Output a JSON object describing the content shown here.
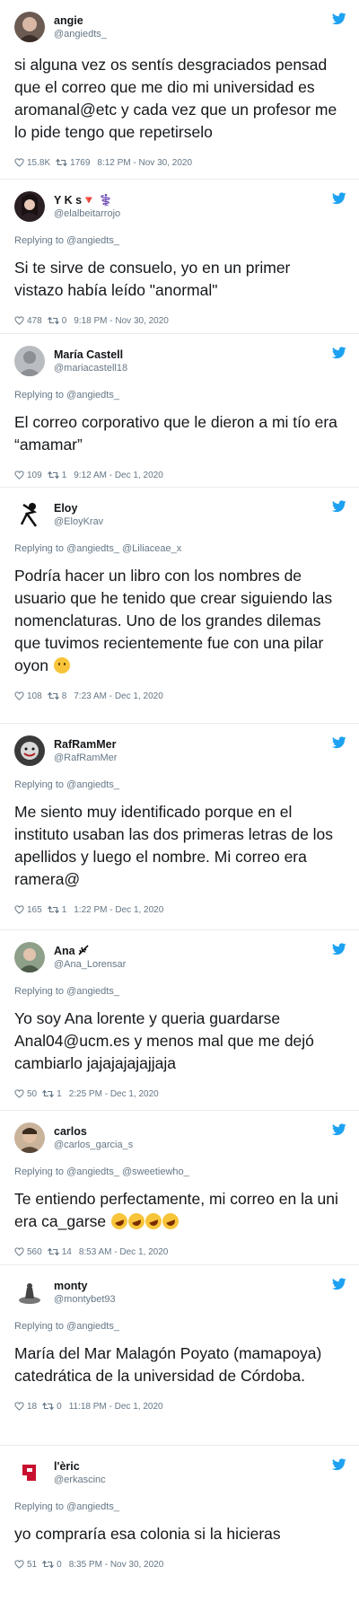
{
  "colors": {
    "accent": "#1da1f2",
    "muted": "#657786",
    "text": "#14171a"
  },
  "tweets": [
    {
      "name": "angie",
      "handle": "@angiedts_",
      "reply": "",
      "text": "si alguna vez os sentís desgraciados pensad que el correo que me dio mi universidad es aromanal@etc y cada vez que un profesor me lo pide tengo que repetirselo",
      "likes": "15.8K",
      "retweets": "1769",
      "time": "8:12 PM - Nov 30, 2020"
    },
    {
      "name": "Y      K  s🔻 ⚕️",
      "handle": "@elalbeitarrojo",
      "reply": "Replying to @angiedts_",
      "text": "Si te sirve de consuelo, yo en un primer vistazo había leído \"anormal\"",
      "likes": "478",
      "retweets": "0",
      "time": "9:18 PM - Nov 30, 2020"
    },
    {
      "name": "María Castell",
      "handle": "@mariacastell18",
      "reply": "Replying to @angiedts_",
      "text": "El correo corporativo que le dieron a mi tío era “amamar”",
      "likes": "109",
      "retweets": "1",
      "time": "9:12 AM - Dec 1, 2020"
    },
    {
      "name": "Eloy",
      "handle": "@EloyKrav",
      "reply": "Replying to @angiedts_ @Liliaceae_x",
      "text": "Podría hacer un libro con los nombres de usuario que he tenido que crear siguiendo las nomenclaturas. Uno de los grandes dilemas que tuvimos recientemente fue con una pilar oyon",
      "likes": "108",
      "retweets": "8",
      "time": "7:23 AM - Dec 1, 2020"
    },
    {
      "name": "RafRamMer",
      "handle": "@RafRamMer",
      "reply": "Replying to @angiedts_",
      "text": "Me siento muy identificado porque en el instituto usaban las dos primeras letras de los apellidos y luego el nombre. Mi correo era ramera@",
      "likes": "165",
      "retweets": "1",
      "time": "1:22 PM - Dec 1, 2020"
    },
    {
      "name": "Ana",
      "handle": "@Ana_Lorensar",
      "reply": "Replying to @angiedts_",
      "text": "Yo soy Ana lorente y queria guardarse Anal04@ucm.es y menos mal que me dejó cambiarlo jajajajajajjaja",
      "likes": "50",
      "retweets": "1",
      "time": "2:25 PM - Dec 1, 2020"
    },
    {
      "name": "carlos",
      "handle": "@carlos_garcia_s",
      "reply": "Replying to @angiedts_ @sweetiewho_",
      "text": "Te entiendo perfectamente, mi correo en la uni era ca_garse",
      "likes": "560",
      "retweets": "14",
      "time": "8:53 AM - Dec 1, 2020"
    },
    {
      "name": "monty",
      "handle": "@montybet93",
      "reply": "Replying to @angiedts_",
      "text": "María del Mar Malagón Poyato (mamapoya) catedrática de la universidad de Córdoba.",
      "likes": "18",
      "retweets": "0",
      "time": "11:18 PM - Dec 1, 2020"
    },
    {
      "name": "l'èric",
      "handle": "@erkascinc",
      "reply": "Replying to @angiedts_",
      "text": "yo compraría esa colonia si la hicieras",
      "likes": "51",
      "retweets": "0",
      "time": "8:35 PM - Nov 30, 2020"
    }
  ]
}
